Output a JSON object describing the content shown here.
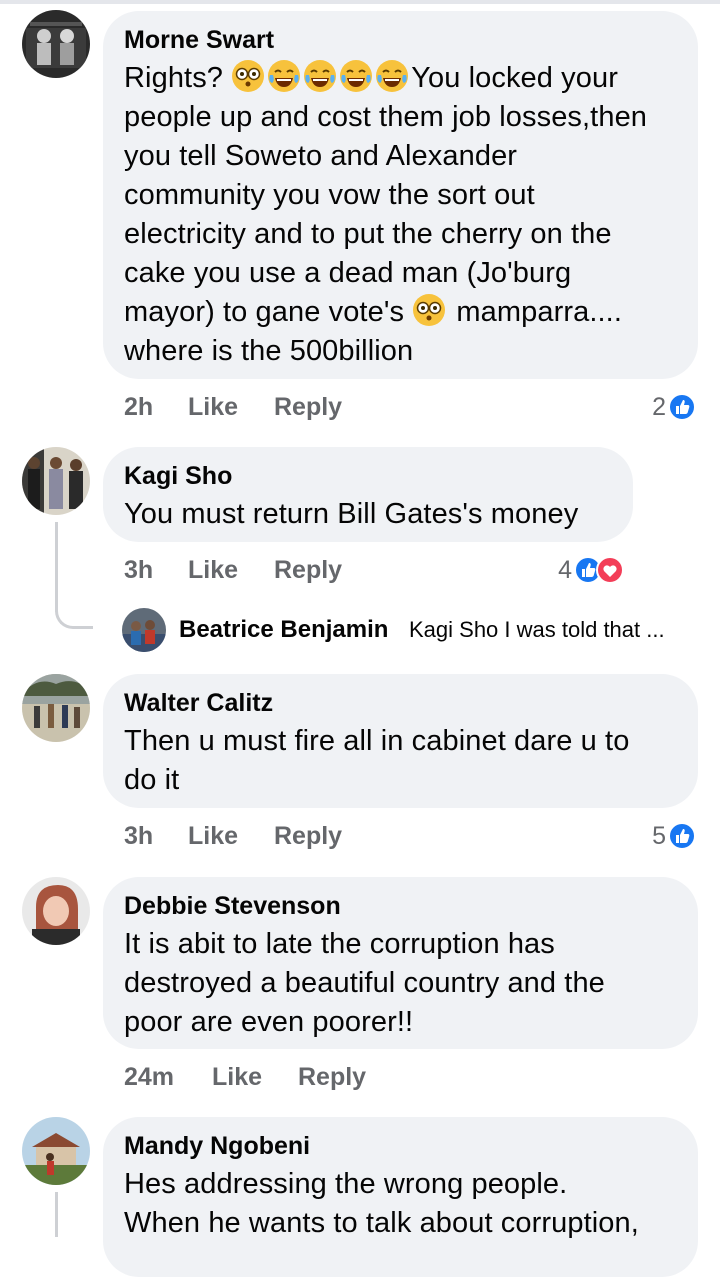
{
  "comments": [
    {
      "name": "Morne Swart",
      "text_before_emoji": "Rights? ",
      "emoji_run": [
        "flushed-face-icon",
        "tears-of-joy-icon",
        "tears-of-joy-icon",
        "tears-of-joy-icon",
        "tears-of-joy-icon"
      ],
      "text_lines": [
        "You locked your",
        "people up and cost them job losses,then",
        "you tell Soweto and Alexander",
        "community you vow the sort out",
        "electricity and to put the cherry on the",
        "cake you use a dead man (Jo'burg",
        "mayor) to gane vote's",
        "mamparra....",
        "where is the 500billion"
      ],
      "time": "2h",
      "like": "Like",
      "reply": "Reply",
      "reaction_count": "2",
      "reactions": [
        "like-icon"
      ]
    },
    {
      "name": "Kagi Sho",
      "text": "You must return Bill Gates's money",
      "time": "3h",
      "like": "Like",
      "reply": "Reply",
      "reaction_count": "4",
      "reactions": [
        "like-icon",
        "love-icon"
      ],
      "reply_preview": {
        "name": "Beatrice Benjamin",
        "text": "Kagi Sho I was told that ..."
      }
    },
    {
      "name": "Walter Calitz",
      "text_lines": [
        "Then u must fire all in cabinet dare u to",
        "do it"
      ],
      "time": "3h",
      "like": "Like",
      "reply": "Reply",
      "reaction_count": "5",
      "reactions": [
        "like-icon"
      ]
    },
    {
      "name": "Debbie Stevenson",
      "text_lines": [
        "It is abit to late the corruption has",
        "destroyed a beautiful country and  the",
        "poor are even poorer!!"
      ],
      "time": "24m",
      "like": "Like",
      "reply": "Reply"
    },
    {
      "name": "Mandy Ngobeni",
      "text_lines": [
        "Hes addressing the wrong people.",
        "When he wants to talk about corruption,"
      ]
    }
  ],
  "colors": {
    "bubble": "#f0f2f5",
    "meta_text": "#65676b",
    "like_blue": "#1877f2",
    "love_red": "#f33e58",
    "thread_line": "#ced0d4"
  }
}
